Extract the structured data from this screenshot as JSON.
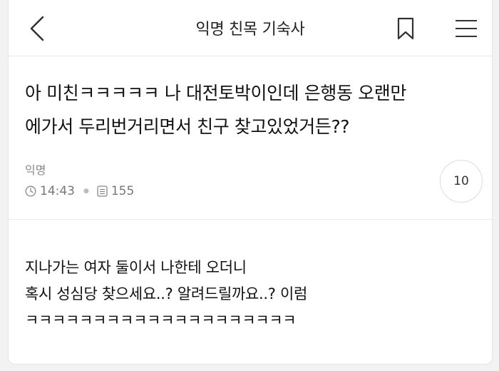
{
  "header": {
    "title": "익명 친목 기숙사",
    "back_icon": "chevron-left-icon",
    "bookmark_icon": "bookmark-icon",
    "menu_icon": "hamburger-menu-icon"
  },
  "post": {
    "title_line1": "아 미친ㅋㅋㅋㅋㅋ 나 대전토박이인데 은행동 오랜만",
    "title_line2": "에가서 두리번거리면서 친구 찾고있었거든??",
    "author": "익명",
    "time": "14:43",
    "views": "155",
    "comment_count": "10"
  },
  "content": {
    "line1": "지나가는 여자 둘이서 나한테 오더니",
    "line2": "혹시 성심당 찾으세요..? 알려드릴까요..? 이럼",
    "line3": "ㅋㅋㅋㅋㅋㅋㅋㅋㅋㅋㅋㅋㅋㅋㅋㅋㅋㅋㅋㅋ"
  },
  "colors": {
    "background": "#ffffff",
    "divider": "#e9e9e9",
    "muted_text": "#888888"
  }
}
